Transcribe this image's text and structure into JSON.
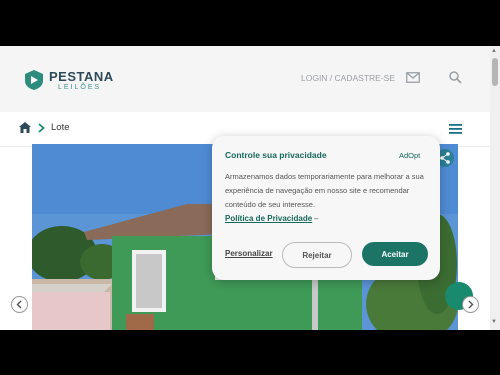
{
  "header": {
    "brand_name": "PESTANA",
    "brand_sub": "LEILÕES",
    "login_label": "LOGIN / CADASTRE-SE",
    "icons": [
      "mail-icon",
      "search-icon"
    ]
  },
  "breadcrumb": {
    "current": "Lote",
    "icons": [
      "home-icon",
      "chevron-right-icon",
      "menu-icon"
    ]
  },
  "consent": {
    "title": "Controle sua privacidade",
    "brand": "AdOpt",
    "text": "Armazenamos dados temporariamente para melhorar a sua experiência de navegação em nosso site e recomendar conteúdo de seu interesse.",
    "policy_link": "Política de Privacidade",
    "dash": "–",
    "personalize": "Personalizar",
    "reject": "Rejeitar",
    "accept": "Aceitar"
  },
  "colors": {
    "brand_teal": "#16675c",
    "accept_bg": "#1c7466",
    "share_bg": "#2b7f96"
  }
}
